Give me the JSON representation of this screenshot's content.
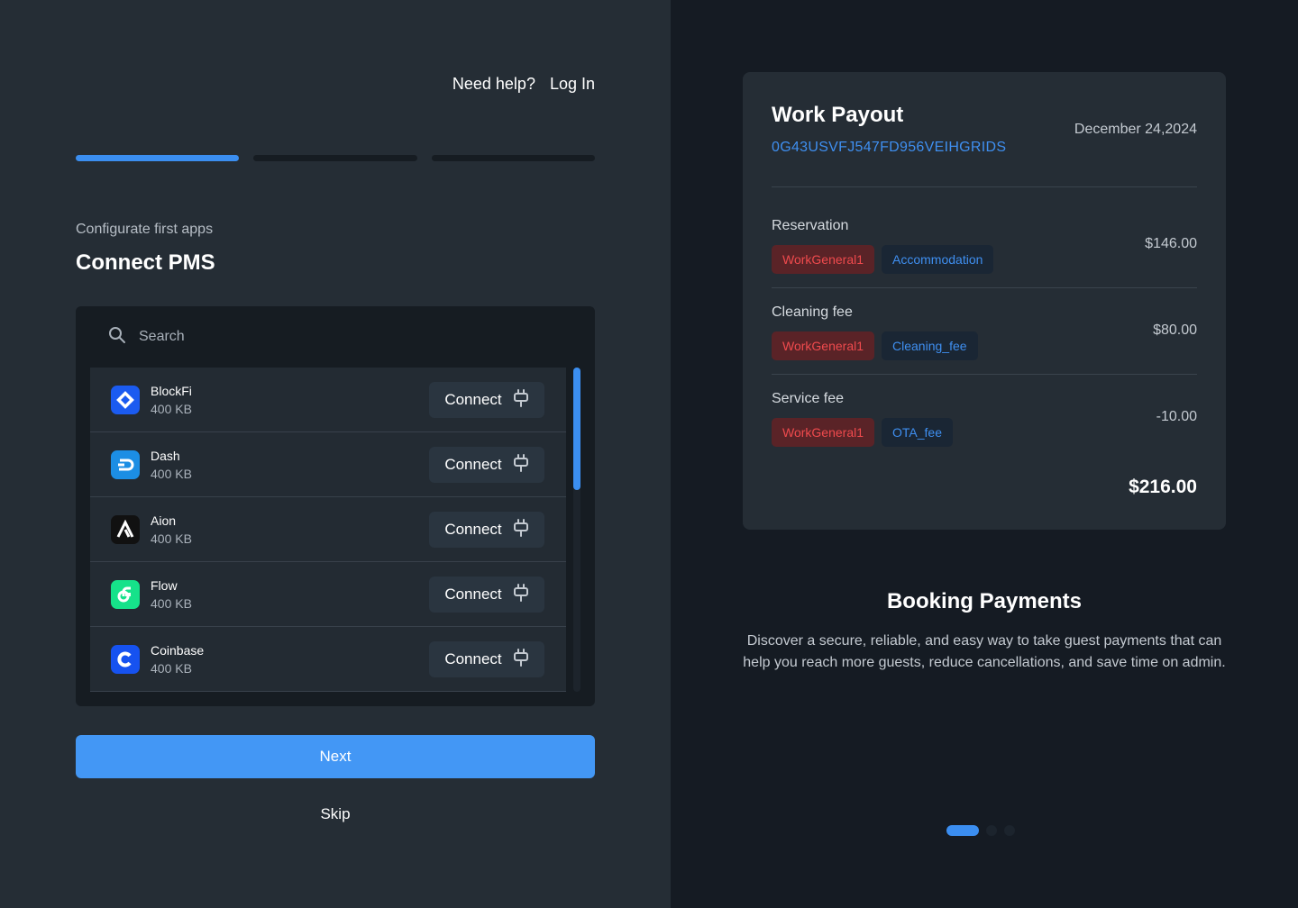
{
  "nav": {
    "help": "Need help?",
    "login": "Log In"
  },
  "progress": {
    "total_steps": 3,
    "current_step": 1
  },
  "setup": {
    "subtitle": "Configurate first apps",
    "title": "Connect PMS"
  },
  "search": {
    "placeholder": "Search"
  },
  "apps": [
    {
      "name": "BlockFi",
      "size": "400 KB",
      "action": "Connect",
      "icon": "blockfi-icon",
      "color": "#1b5bf0"
    },
    {
      "name": "Dash",
      "size": "400 KB",
      "action": "Connect",
      "icon": "dash-icon",
      "color": "#1c8ee4"
    },
    {
      "name": "Aion",
      "size": "400 KB",
      "action": "Connect",
      "icon": "aion-icon",
      "color": "#111111"
    },
    {
      "name": "Flow",
      "size": "400 KB",
      "action": "Connect",
      "icon": "flow-icon",
      "color": "#16e28a"
    },
    {
      "name": "Coinbase",
      "size": "400 KB",
      "action": "Connect",
      "icon": "coinbase-icon",
      "color": "#1652f0"
    }
  ],
  "buttons": {
    "next": "Next",
    "skip": "Skip"
  },
  "payout": {
    "title": "Work Payout",
    "id": "0G43USVFJ547FD956VEIHGRIDS",
    "date": "December 24,2024",
    "lines": [
      {
        "label": "Reservation",
        "amount": "$146.00",
        "tags": [
          {
            "text": "WorkGeneral1",
            "tone": "red"
          },
          {
            "text": "Accommodation",
            "tone": "blue"
          }
        ]
      },
      {
        "label": "Cleaning fee",
        "amount": "$80.00",
        "tags": [
          {
            "text": "WorkGeneral1",
            "tone": "red"
          },
          {
            "text": "Cleaning_fee",
            "tone": "blue"
          }
        ]
      },
      {
        "label": "Service fee",
        "amount": "-10.00",
        "tags": [
          {
            "text": "WorkGeneral1",
            "tone": "red"
          },
          {
            "text": "OTA_fee",
            "tone": "blue"
          }
        ]
      }
    ],
    "total": "$216.00"
  },
  "promo": {
    "title": "Booking Payments",
    "description": "Discover a secure, reliable, and easy way to take guest payments that can help you reach more guests, reduce cancellations, and save time on admin."
  },
  "carousel": {
    "total_slides": 3,
    "current_slide": 1
  },
  "colors": {
    "accent": "#3b8ef0",
    "tag_red": "#ef4a4d",
    "tag_blue": "#3f8ff0"
  }
}
